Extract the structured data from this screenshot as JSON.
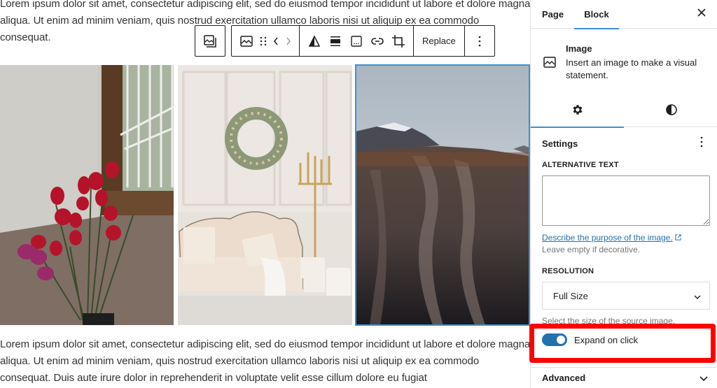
{
  "editor": {
    "paragraph_top": "Lorem ipsum dolor sit amet, consectetur adipiscing elit, sed do eiusmod tempor incididunt ut labore et dolore magna aliqua. Ut enim ad minim veniam, quis nostrud exercitation ullamco laboris nisi ut aliquip ex ea commodo consequat.",
    "paragraph_bottom": "Lorem ipsum dolor sit amet, consectetur adipiscing elit, sed do eiusmod tempor incididunt ut labore et dolore magna aliqua. Ut enim ad minim veniam, quis nostrud exercitation ullamco laboris nisi ut aliquip ex ea commodo consequat. Duis aute irure dolor in reprehenderit in voluptate velit esse cillum dolore eu fugiat",
    "gallery": [
      {
        "subject": "red tulips by window",
        "selected": false
      },
      {
        "subject": "white sofa with wreath and candelabra",
        "selected": false
      },
      {
        "subject": "mountain under clouds",
        "selected": true
      }
    ]
  },
  "toolbar": {
    "icons": [
      "gallery-parent-icon",
      "image-icon",
      "drag-handle-icon",
      "move-left-icon",
      "move-right-icon",
      "duotone-icon",
      "align-icon",
      "caption-icon",
      "link-icon",
      "crop-icon",
      "more-options-icon"
    ],
    "replace_label": "Replace"
  },
  "sidebar": {
    "tabs": [
      {
        "label": "Page",
        "active": false
      },
      {
        "label": "Block",
        "active": true
      }
    ],
    "block": {
      "title": "Image",
      "description": "Insert an image to make a visual statement."
    },
    "sub_tabs": [
      {
        "icon": "settings-gear-icon",
        "active": true
      },
      {
        "icon": "styles-contrast-icon",
        "active": false
      }
    ],
    "settings": {
      "title": "Settings",
      "alt_text": {
        "label": "Alternative Text",
        "value": "",
        "link": "Describe the purpose of the image.",
        "help": "Leave empty if decorative."
      },
      "resolution": {
        "label": "Resolution",
        "selected": "Full Size",
        "help": "Select the size of the source image."
      },
      "expand_on_click": {
        "label": "Expand on click",
        "enabled": true
      }
    },
    "advanced_label": "Advanced"
  },
  "colors": {
    "accent": "#3f8fd0",
    "toggle_on": "#2271b1",
    "highlight": "#ff0000"
  }
}
